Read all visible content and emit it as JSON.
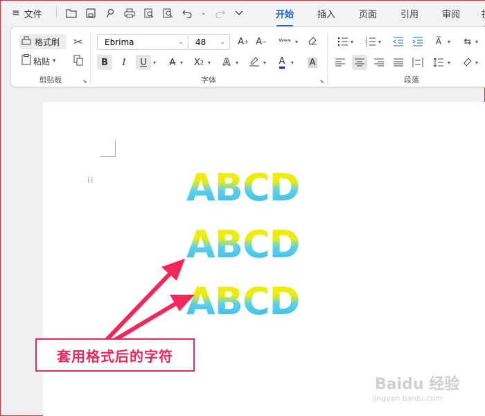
{
  "topbar": {
    "file_label": "文件",
    "hamburger_icon": "≡",
    "quick_access": [
      "open-folder-icon",
      "save-icon",
      "format-painter-icon",
      "print-icon",
      "print-preview-icon",
      "find-icon",
      "undo-icon",
      "redo-icon",
      "more-icon"
    ],
    "tabs": [
      "开始",
      "插入",
      "页面",
      "引用",
      "审阅",
      "视"
    ]
  },
  "ribbon": {
    "clipboard": {
      "format_painter": "格式刷",
      "paste": "粘贴",
      "label": "剪贴板"
    },
    "font": {
      "family": "Ebrima",
      "size": "48",
      "label": "字体"
    },
    "paragraph": {
      "label": "段落"
    }
  },
  "document": {
    "lines": [
      "ABCD",
      "ABCD",
      "ABCD"
    ],
    "callout": "套用格式后的字符",
    "accent_color": "#e8285a",
    "gradient": [
      "#f6ee00",
      "#2eb8e6"
    ]
  },
  "watermark": {
    "brand": "Baidu 经验",
    "url": "jingyan.baidu.com"
  }
}
